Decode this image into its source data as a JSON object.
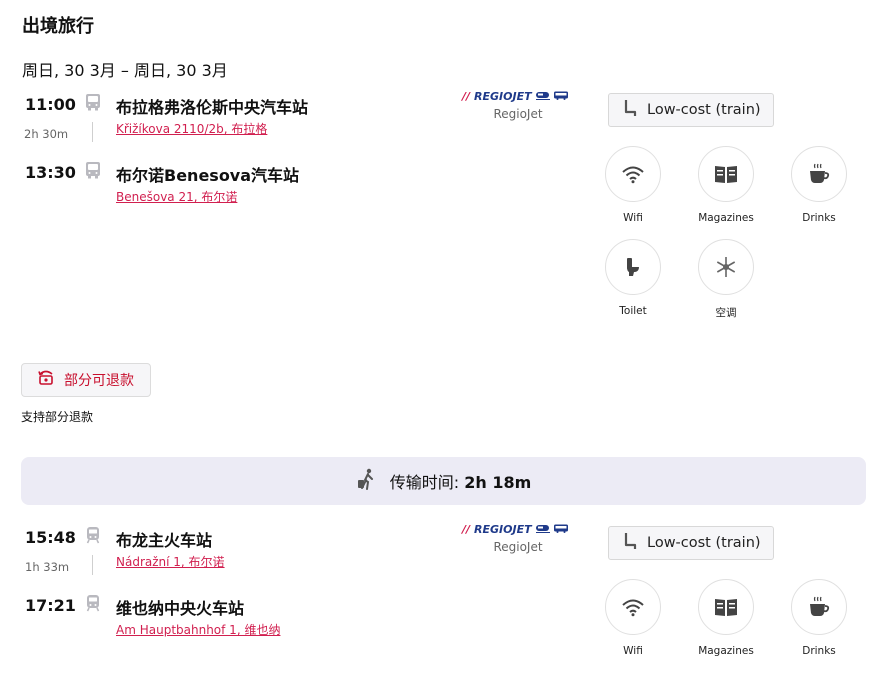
{
  "title": "出境旅行",
  "date": "周日, 30 3月 – 周日, 30 3月",
  "legs": [
    {
      "dep_time": "11:00",
      "duration": "2h 30m",
      "arr_time": "13:30",
      "dep_station": "布拉格弗洛伦斯中央汽车站",
      "dep_address": "Křižíkova 2110/2b, 布拉格",
      "arr_station": "布尔诺Benesova汽车站",
      "arr_address": "Benešova 21, 布尔诺",
      "vehicle_icon": "bus-icon",
      "carrier_logo": "REGIOJET",
      "carrier_name": "RegioJet",
      "fare": "Low-cost (train)",
      "amenities": [
        "Wifi",
        "Magazines",
        "Drinks",
        "Toilet",
        "空调"
      ]
    },
    {
      "dep_time": "15:48",
      "duration": "1h 33m",
      "arr_time": "17:21",
      "dep_station": "布龙主火车站",
      "dep_address": "Nádražní 1, 布尔诺",
      "arr_station": "维也纳中央火车站",
      "arr_address": "Am Hauptbahnhof 1, 维也纳",
      "vehicle_icon": "train-icon",
      "carrier_logo": "REGIOJET",
      "carrier_name": "RegioJet",
      "fare": "Low-cost (train)",
      "amenities": [
        "Wifi",
        "Magazines",
        "Drinks"
      ]
    }
  ],
  "refund": {
    "button_label": "部分可退款",
    "note": "支持部分退款"
  },
  "transfer": {
    "label": "传输时间:",
    "value": "2h 18m"
  },
  "colors": {
    "accent": "#d11f4f",
    "brand_blue": "#1f3a8a",
    "transfer_bg": "#ecebf5"
  }
}
